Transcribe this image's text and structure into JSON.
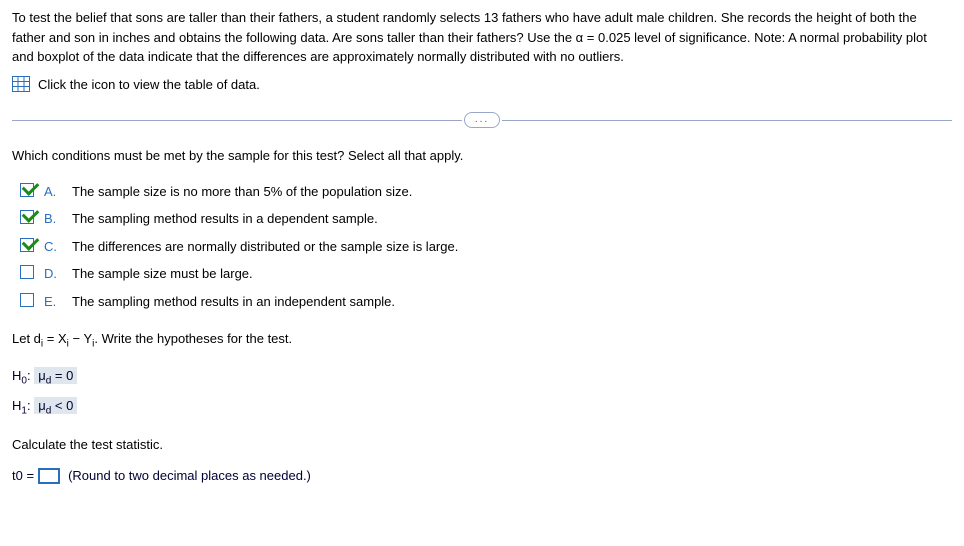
{
  "intro": "To test the belief that sons are taller than their fathers, a student randomly selects 13 fathers who have adult male children. She records the height of both the father and son in inches and obtains the following data. Are sons taller than their fathers? Use the α = 0.025 level of significance. Note: A normal probability plot and boxplot of the data indicate that the differences are approximately normally distributed with no outliers.",
  "click_text": "Click the icon to view the table of data.",
  "ellipsis": "...",
  "question": "Which conditions must be met by the sample for this test? Select all that apply.",
  "choices": [
    {
      "letter": "A.",
      "text": "The sample size is no more than 5% of the population size.",
      "checked": true
    },
    {
      "letter": "B.",
      "text": "The sampling method results in a dependent sample.",
      "checked": true
    },
    {
      "letter": "C.",
      "text": "The differences are normally distributed or the sample size is large.",
      "checked": true
    },
    {
      "letter": "D.",
      "text": "The sample size must be large.",
      "checked": false
    },
    {
      "letter": "E.",
      "text": "The sampling method results in an independent sample.",
      "checked": false
    }
  ],
  "let_prefix": "Let d",
  "let_sub": "i",
  "let_mid": " = X",
  "let_xsub": "i",
  "let_mid2": " − Y",
  "let_ysub": "i",
  "let_suffix": ". Write the hypotheses for the test.",
  "h0_label": "H",
  "h0_sub": "0",
  "h0_colon": ": ",
  "h0_content": "μd = 0",
  "h1_label": "H",
  "h1_sub": "1",
  "h1_colon": ": ",
  "h1_content": "μd < 0",
  "calc_text": "Calculate the test statistic.",
  "t_label": "t",
  "t_sub": "0",
  "t_eq": " =",
  "round_note": "(Round to two decimal places as needed.)"
}
